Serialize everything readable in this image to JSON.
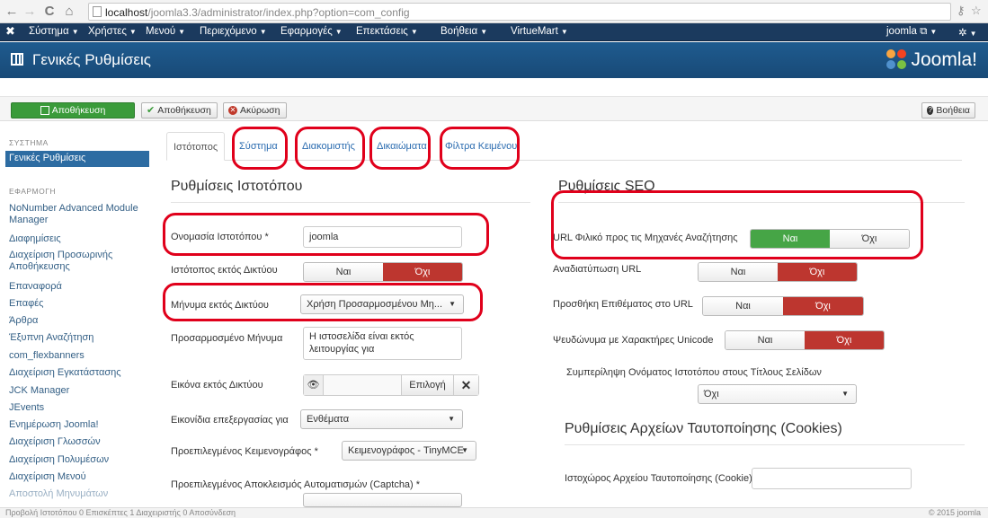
{
  "browser": {
    "url_host": "localhost",
    "url_path": "/joomla3.3/administrator/index.php?option=com_config"
  },
  "admin_menu": {
    "items": [
      "Σύστημα",
      "Χρήστες",
      "Μενού",
      "Περιεχόμενο",
      "Εφαρμογές",
      "Επεκτάσεις",
      "Βοήθεια",
      "VirtueMart"
    ],
    "user_label": "joomla"
  },
  "header": {
    "page_title": "Γενικές Ρυθμίσεις",
    "brand": "Joomla!"
  },
  "toolbar": {
    "save_label": "Αποθήκευση",
    "apply_label": "Αποθήκευση",
    "cancel_label": "Ακύρωση",
    "help_label": "Βοήθεια"
  },
  "sidebar": {
    "system_heading": "ΣΥΣΤΗΜΑ",
    "active_item": "Γενικές Ρυθμίσεις",
    "apps_heading": "ΕΦΑΡΜΟΓΗ",
    "items": [
      "NoNumber Advanced Module Manager",
      "Διαφημίσεις",
      "Διαχείριση Προσωρινής Αποθήκευσης",
      "Επαναφορά",
      "Επαφές",
      "Άρθρα",
      "Έξυπνη Αναζήτηση",
      "com_flexbanners",
      "Διαχείριση Εγκατάστασης",
      "JCK Manager",
      "JEvents",
      "Ενημέρωση Joomla!",
      "Διαχείριση Γλωσσών",
      "Διαχείριση Πολυμέσων",
      "Διαχείριση Μενού",
      "Αποστολή Μηνυμάτων"
    ]
  },
  "tabs": [
    "Ιστότοπος",
    "Σύστημα",
    "Διακομιστής",
    "Δικαιώματα",
    "Φίλτρα Κειμένου"
  ],
  "site": {
    "section_title": "Ρυθμίσεις Ιστοτόπου",
    "site_name_label": "Ονομασία Ιστοτόπου *",
    "site_name_value": "joomla",
    "offline_label": "Ιστότοπος εκτός Δικτύου",
    "offline_yes": "Ναι",
    "offline_no": "Όχι",
    "offline_message_label": "Μήνυμα εκτός Δικτύου",
    "offline_message_value": "Χρήση Προσαρμοσμένου Μη...",
    "custom_message_label": "Προσαρμοσμένο Μήνυμα",
    "custom_message_line1": "Η ιστοσελίδα είναι εκτός",
    "custom_message_line2": "λειτουργίας για",
    "offline_image_label": "Εικόνα εκτός Δικτύου",
    "offline_image_select": "Επιλογή",
    "edit_icons_label": "Εικονίδια επεξεργασίας για",
    "edit_icons_value": "Ενθέματα",
    "default_editor_label": "Προεπιλεγμένος Κειμενογράφος *",
    "default_editor_value": "Κειμενογράφος - TinyMCE",
    "default_captcha_label": "Προεπιλεγμένος Αποκλεισμός Αυτοματισμών (Captcha) *"
  },
  "seo": {
    "section_title": "Ρυθμίσεις SEO",
    "sef_label": "URL Φιλικό προς τις Μηχανές Αναζήτησης",
    "rewrite_label": "Αναδιατύπωση URL",
    "suffix_label": "Προσθήκη Επιθέματος στο URL",
    "unicode_label": "Ψευδώνυμα με Χαρακτήρες Unicode",
    "sitename_pages_label": "Συμπερίληψη Ονόματος Ιστοτόπου στους Τίτλους Σελίδων",
    "sitename_pages_value": "Όχι",
    "yes": "Ναι",
    "no": "Όχι"
  },
  "cookies": {
    "section_title": "Ρυθμίσεις Αρχείων Ταυτοποίησης (Cookies)",
    "domain_label": "Ιστοχώρος Αρχείου Ταυτοποίησης (Cookie)"
  },
  "status": {
    "left": "Προβολή Ιστοτόπου  0 Επισκέπτες  1 Διαχειριστής  0  Αποσύνδεση",
    "right": "© 2015 joomla"
  },
  "colors": {
    "annotation": "#e0001b",
    "navy": "#1b3a5e",
    "title_blue": "#1f5b8f",
    "green": "#46a546",
    "red": "#bd362f"
  }
}
